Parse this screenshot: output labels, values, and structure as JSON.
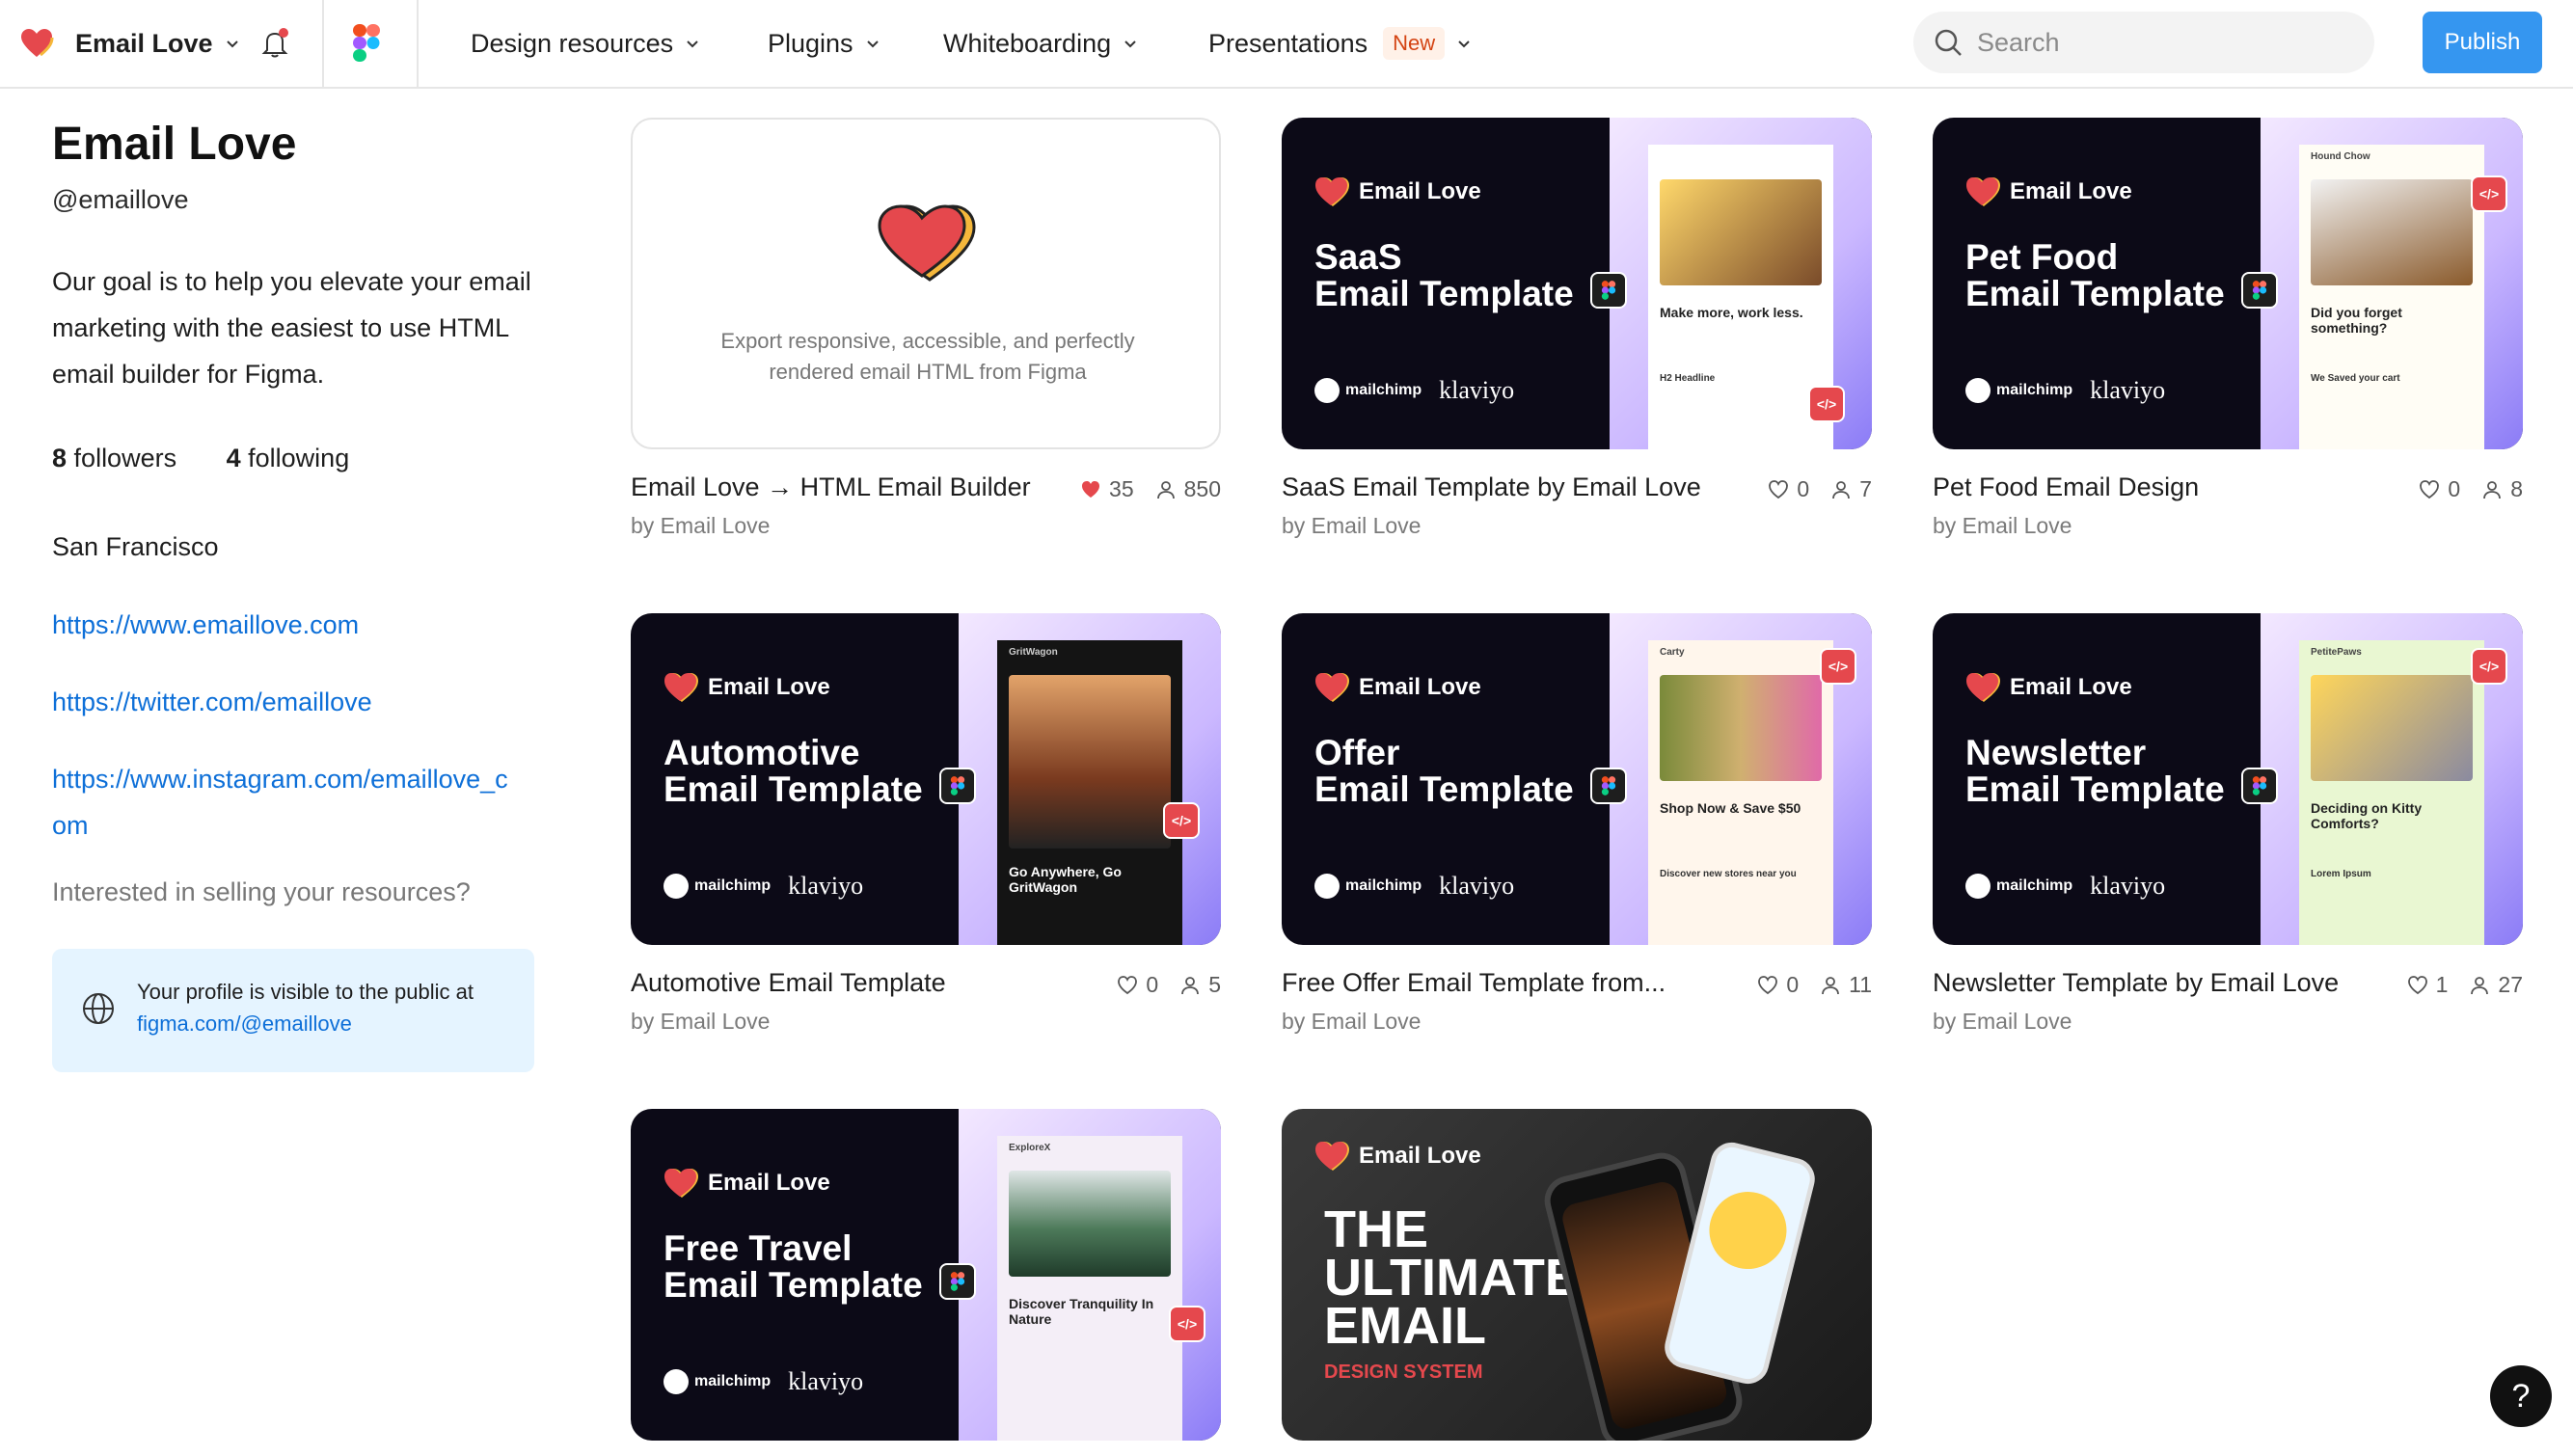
{
  "topbar": {
    "team_name": "Email Love",
    "nav": [
      {
        "label": "Design resources"
      },
      {
        "label": "Plugins"
      },
      {
        "label": "Whiteboarding"
      },
      {
        "label": "Presentations",
        "badge": "New"
      }
    ],
    "search_placeholder": "Search",
    "publish_label": "Publish"
  },
  "profile": {
    "name": "Email Love",
    "handle": "@emaillove",
    "bio": "Our goal is to help you elevate your email marketing with the easiest to use HTML email builder for Figma.",
    "followers_count": "8",
    "followers_label": "followers",
    "following_count": "4",
    "following_label": "following",
    "location": "San Francisco",
    "links": [
      {
        "line1": "https://www.emaillove.com",
        "line2": ""
      },
      {
        "line1": "https://twitter.com/emaillove",
        "line2": ""
      },
      {
        "line1": "https://www.instagram.com/emaillove_c",
        "line2": "om"
      }
    ],
    "selling_text": "Interested in selling your resources?",
    "public_notice": "Your profile is visible to the public at",
    "public_url": "figma.com/@emaillove"
  },
  "colors": {
    "accent": "#3596f0",
    "link": "#0d6fd8",
    "heart": "#e5484d",
    "dark_card": "#0c0a17"
  },
  "cards": [
    {
      "title": "Email Love → HTML Email Builder",
      "by": "by Email Love",
      "likes": "35",
      "users": "850",
      "liked": true,
      "thumb_text": "Export responsive, accessible, and perfectly rendered email HTML from Figma"
    },
    {
      "title": "SaaS Email Template by Email Love",
      "by": "by Email Love",
      "likes": "0",
      "users": "7",
      "thumb": {
        "brand": "Email Love",
        "line1": "SaaS",
        "line2": "Email Template",
        "esp1": "mailchimp",
        "esp2": "klaviyo",
        "mock_title": "Make more, work less.",
        "mock_sub": "H2 Headline"
      }
    },
    {
      "title": "Pet Food Email Design",
      "by": "by Email Love",
      "likes": "0",
      "users": "8",
      "thumb": {
        "brand": "Email Love",
        "line1": "Pet Food",
        "line2": "Email Template",
        "esp1": "mailchimp",
        "esp2": "klaviyo",
        "mock_brand": "Hound Chow",
        "mock_title": "Did you forget something?",
        "mock_sub": "We Saved your cart"
      }
    },
    {
      "title": "Automotive Email Template",
      "by": "by Email Love",
      "likes": "0",
      "users": "5",
      "thumb": {
        "brand": "Email Love",
        "line1": "Automotive",
        "line2": "Email Template",
        "esp1": "mailchimp",
        "esp2": "klaviyo",
        "mock_brand": "GritWagon",
        "mock_title": "Go Anywhere, Go GritWagon"
      }
    },
    {
      "title": "Free Offer Email Template from...",
      "by": "by Email Love",
      "likes": "0",
      "users": "11",
      "thumb": {
        "brand": "Email Love",
        "line1": "Offer",
        "line2": "Email Template",
        "esp1": "mailchimp",
        "esp2": "klaviyo",
        "mock_brand": "Carty",
        "mock_title": "Shop Now & Save $50",
        "mock_sub": "Discover new stores near you"
      }
    },
    {
      "title": "Newsletter Template by Email Love",
      "by": "by Email Love",
      "likes": "1",
      "users": "27",
      "thumb": {
        "brand": "Email Love",
        "line1": "Newsletter",
        "line2": "Email Template",
        "esp1": "mailchimp",
        "esp2": "klaviyo",
        "mock_brand": "PetitePaws",
        "mock_title": "Deciding on Kitty Comforts?",
        "mock_sub": "Lorem Ipsum"
      }
    },
    {
      "title": "",
      "by": "",
      "likes": "",
      "users": "",
      "thumb": {
        "brand": "Email Love",
        "line1": "Free Travel",
        "line2": "Email Template",
        "esp1": "mailchimp",
        "esp2": "klaviyo",
        "mock_brand": "ExploreX",
        "mock_title": "Discover Tranquility In Nature"
      }
    },
    {
      "title": "",
      "by": "",
      "likes": "",
      "users": "",
      "thumb": {
        "brand": "Email Love",
        "line1": "THE",
        "line2": "ULTIMATE",
        "line3": "EMAIL",
        "line4": "DESIGN SYSTEM"
      }
    }
  ],
  "help_label": "?"
}
